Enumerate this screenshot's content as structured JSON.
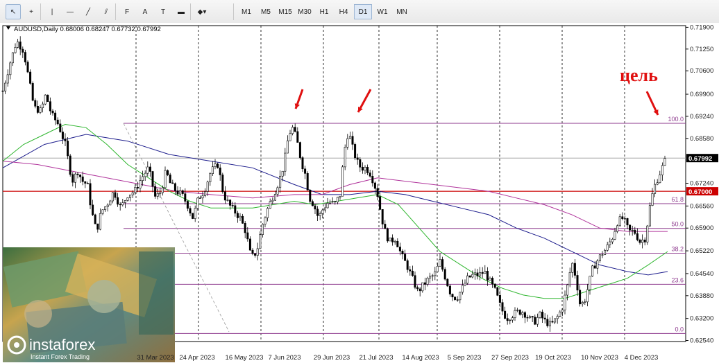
{
  "toolbar": {
    "tools": [
      {
        "name": "cursor-icon",
        "glyph": "↖"
      },
      {
        "name": "crosshair-icon",
        "glyph": "+"
      },
      {
        "name": "vertical-line-icon",
        "glyph": "|"
      },
      {
        "name": "horizontal-line-icon",
        "glyph": "—"
      },
      {
        "name": "trendline-icon",
        "glyph": "╱"
      },
      {
        "name": "equidistant-channel-icon",
        "glyph": "⫽"
      },
      {
        "name": "fibonacci-icon",
        "glyph": "F"
      },
      {
        "name": "text-icon",
        "glyph": "A"
      },
      {
        "name": "text-label-icon",
        "glyph": "T"
      },
      {
        "name": "rectangle-icon",
        "glyph": "▬"
      },
      {
        "name": "shapes-menu-icon",
        "glyph": "◆▾"
      }
    ],
    "timeframes": [
      "M1",
      "M5",
      "M15",
      "M30",
      "H1",
      "H4",
      "D1",
      "W1",
      "MN"
    ],
    "active_timeframe": "D1"
  },
  "chart_header": "AUDUSD,Daily  0.68006 0.68247 0.67732 0.67992",
  "annotation": "цель",
  "watermark": {
    "brand": "instaforex",
    "tagline": "Instant Forex Trading"
  },
  "chart_data": {
    "type": "candlestick",
    "symbol": "AUDUSD",
    "timeframe": "Daily",
    "ohlc_last": {
      "open": 0.68006,
      "high": 0.68247,
      "low": 0.67732,
      "close": 0.67992
    },
    "ylim": [
      0.6251,
      0.7195
    ],
    "y_ticks": [
      0.719,
      0.7125,
      0.706,
      0.699,
      0.6924,
      0.6858,
      0.6724,
      0.6656,
      0.659,
      0.6522,
      0.6454,
      0.6388,
      0.632,
      0.6254
    ],
    "x_labels": [
      "31 Mar 2023",
      "24 Apr 2023",
      "16 May 2023",
      "7 Jun 2023",
      "29 Jun 2023",
      "21 Jul 2023",
      "14 Aug 2023",
      "5 Sep 2023",
      "27 Sep 2023",
      "19 Oct 2023",
      "10 Nov 2023",
      "4 Dec 2023"
    ],
    "current_price": 0.67992,
    "horizontal_level": 0.67,
    "fibonacci": [
      {
        "label": "100.0",
        "price": 0.6903
      },
      {
        "label": "61.8",
        "price": 0.6663
      },
      {
        "label": "50.0",
        "price": 0.6589
      },
      {
        "label": "38.2",
        "price": 0.6515
      },
      {
        "label": "23.6",
        "price": 0.6422
      },
      {
        "label": "0.0",
        "price": 0.6275
      }
    ],
    "close_path": [
      [
        0,
        0.7
      ],
      [
        10,
        0.708
      ],
      [
        20,
        0.715
      ],
      [
        30,
        0.712
      ],
      [
        38,
        0.703
      ],
      [
        45,
        0.695
      ],
      [
        55,
        0.694
      ],
      [
        62,
        0.699
      ],
      [
        70,
        0.693
      ],
      [
        80,
        0.69
      ],
      [
        90,
        0.684
      ],
      [
        100,
        0.673
      ],
      [
        108,
        0.676
      ],
      [
        115,
        0.673
      ],
      [
        122,
        0.672
      ],
      [
        128,
        0.664
      ],
      [
        135,
        0.658
      ],
      [
        142,
        0.664
      ],
      [
        150,
        0.666
      ],
      [
        160,
        0.67
      ],
      [
        170,
        0.665
      ],
      [
        180,
        0.669
      ],
      [
        190,
        0.67
      ],
      [
        200,
        0.674
      ],
      [
        210,
        0.677
      ],
      [
        220,
        0.668
      ],
      [
        228,
        0.67
      ],
      [
        235,
        0.676
      ],
      [
        242,
        0.672
      ],
      [
        250,
        0.67
      ],
      [
        258,
        0.669
      ],
      [
        266,
        0.666
      ],
      [
        274,
        0.662
      ],
      [
        282,
        0.668
      ],
      [
        290,
        0.67
      ],
      [
        300,
        0.676
      ],
      [
        310,
        0.678
      ],
      [
        318,
        0.669
      ],
      [
        326,
        0.666
      ],
      [
        334,
        0.664
      ],
      [
        342,
        0.662
      ],
      [
        350,
        0.658
      ],
      [
        358,
        0.65
      ],
      [
        366,
        0.652
      ],
      [
        374,
        0.66
      ],
      [
        382,
        0.665
      ],
      [
        390,
        0.669
      ],
      [
        398,
        0.673
      ],
      [
        405,
        0.678
      ],
      [
        412,
        0.687
      ],
      [
        418,
        0.689
      ],
      [
        424,
        0.685
      ],
      [
        430,
        0.679
      ],
      [
        436,
        0.675
      ],
      [
        442,
        0.668
      ],
      [
        448,
        0.666
      ],
      [
        455,
        0.662
      ],
      [
        462,
        0.665
      ],
      [
        470,
        0.667
      ],
      [
        478,
        0.666
      ],
      [
        486,
        0.669
      ],
      [
        492,
        0.682
      ],
      [
        498,
        0.688
      ],
      [
        504,
        0.683
      ],
      [
        510,
        0.679
      ],
      [
        516,
        0.677
      ],
      [
        522,
        0.677
      ],
      [
        528,
        0.676
      ],
      [
        534,
        0.673
      ],
      [
        540,
        0.669
      ],
      [
        546,
        0.662
      ],
      [
        552,
        0.657
      ],
      [
        558,
        0.655
      ],
      [
        566,
        0.656
      ],
      [
        574,
        0.651
      ],
      [
        582,
        0.648
      ],
      [
        590,
        0.644
      ],
      [
        598,
        0.64
      ],
      [
        606,
        0.642
      ],
      [
        614,
        0.644
      ],
      [
        622,
        0.645
      ],
      [
        630,
        0.649
      ],
      [
        638,
        0.644
      ],
      [
        646,
        0.639
      ],
      [
        654,
        0.638
      ],
      [
        662,
        0.641
      ],
      [
        670,
        0.644
      ],
      [
        678,
        0.645
      ],
      [
        686,
        0.645
      ],
      [
        694,
        0.646
      ],
      [
        702,
        0.643
      ],
      [
        710,
        0.64
      ],
      [
        718,
        0.635
      ],
      [
        726,
        0.632
      ],
      [
        734,
        0.633
      ],
      [
        742,
        0.634
      ],
      [
        750,
        0.634
      ],
      [
        758,
        0.632
      ],
      [
        766,
        0.631
      ],
      [
        774,
        0.633
      ],
      [
        782,
        0.631
      ],
      [
        790,
        0.63
      ],
      [
        798,
        0.632
      ],
      [
        806,
        0.635
      ],
      [
        814,
        0.642
      ],
      [
        820,
        0.649
      ],
      [
        826,
        0.644
      ],
      [
        832,
        0.636
      ],
      [
        838,
        0.637
      ],
      [
        844,
        0.642
      ],
      [
        850,
        0.647
      ],
      [
        856,
        0.649
      ],
      [
        862,
        0.651
      ],
      [
        870,
        0.653
      ],
      [
        878,
        0.656
      ],
      [
        886,
        0.661
      ],
      [
        894,
        0.662
      ],
      [
        902,
        0.658
      ],
      [
        910,
        0.658
      ],
      [
        918,
        0.655
      ],
      [
        926,
        0.656
      ],
      [
        932,
        0.665
      ],
      [
        938,
        0.671
      ],
      [
        944,
        0.674
      ],
      [
        950,
        0.677
      ],
      [
        956,
        0.68
      ]
    ],
    "ma_slow": [
      [
        0,
        0.677
      ],
      [
        60,
        0.684
      ],
      [
        120,
        0.687
      ],
      [
        180,
        0.685
      ],
      [
        240,
        0.681
      ],
      [
        300,
        0.679
      ],
      [
        360,
        0.677
      ],
      [
        420,
        0.672
      ],
      [
        460,
        0.669
      ],
      [
        500,
        0.669
      ],
      [
        540,
        0.67
      ],
      [
        580,
        0.669
      ],
      [
        620,
        0.667
      ],
      [
        660,
        0.665
      ],
      [
        700,
        0.663
      ],
      [
        740,
        0.659
      ],
      [
        780,
        0.656
      ],
      [
        820,
        0.652
      ],
      [
        860,
        0.648
      ],
      [
        900,
        0.646
      ],
      [
        930,
        0.645
      ],
      [
        958,
        0.646
      ]
    ],
    "ma_magenta": [
      [
        0,
        0.679
      ],
      [
        50,
        0.678
      ],
      [
        100,
        0.676
      ],
      [
        150,
        0.674
      ],
      [
        200,
        0.672
      ],
      [
        250,
        0.67
      ],
      [
        300,
        0.669
      ],
      [
        360,
        0.668
      ],
      [
        420,
        0.669
      ],
      [
        460,
        0.669
      ],
      [
        500,
        0.672
      ],
      [
        540,
        0.674
      ],
      [
        580,
        0.673
      ],
      [
        620,
        0.672
      ],
      [
        660,
        0.671
      ],
      [
        700,
        0.67
      ],
      [
        740,
        0.668
      ],
      [
        780,
        0.666
      ],
      [
        820,
        0.663
      ],
      [
        860,
        0.659
      ],
      [
        900,
        0.658
      ],
      [
        930,
        0.658
      ],
      [
        958,
        0.658
      ]
    ],
    "ma_green": [
      [
        0,
        0.679
      ],
      [
        30,
        0.684
      ],
      [
        60,
        0.687
      ],
      [
        90,
        0.69
      ],
      [
        120,
        0.689
      ],
      [
        150,
        0.684
      ],
      [
        180,
        0.678
      ],
      [
        210,
        0.674
      ],
      [
        240,
        0.67
      ],
      [
        270,
        0.667
      ],
      [
        300,
        0.665
      ],
      [
        330,
        0.665
      ],
      [
        360,
        0.665
      ],
      [
        390,
        0.666
      ],
      [
        420,
        0.667
      ],
      [
        450,
        0.666
      ],
      [
        480,
        0.667
      ],
      [
        510,
        0.668
      ],
      [
        540,
        0.669
      ],
      [
        570,
        0.666
      ],
      [
        600,
        0.659
      ],
      [
        630,
        0.652
      ],
      [
        660,
        0.648
      ],
      [
        690,
        0.644
      ],
      [
        720,
        0.641
      ],
      [
        750,
        0.639
      ],
      [
        780,
        0.638
      ],
      [
        810,
        0.638
      ],
      [
        840,
        0.64
      ],
      [
        870,
        0.642
      ],
      [
        900,
        0.644
      ],
      [
        930,
        0.648
      ],
      [
        958,
        0.652
      ]
    ]
  },
  "colors": {
    "candle": "#000000",
    "level_red": "#cc0000",
    "fib": "#8e3a8e",
    "ma_blue": "#1c1c8c",
    "ma_magenta": "#b0339b",
    "ma_green": "#2cb52c",
    "annotation": "#e01010"
  }
}
